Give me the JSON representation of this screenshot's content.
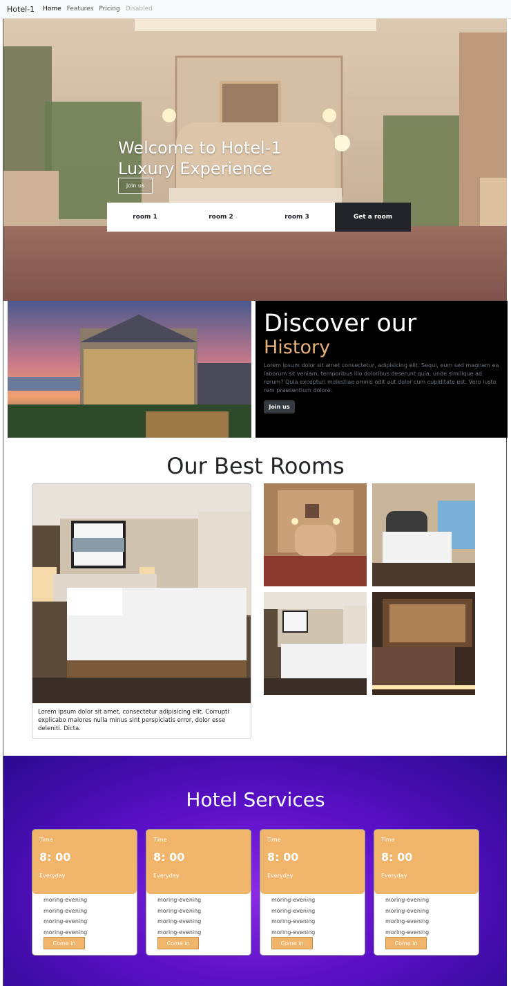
{
  "navbar": {
    "brand": "Hotel-1",
    "links": [
      "Home",
      "Features",
      "Pricing",
      "Disabled"
    ]
  },
  "hero": {
    "title_line1": "Welcome to Hotel-1",
    "title_line2": "Luxury Experience",
    "join_label": "Join us",
    "tabs": [
      "room 1",
      "room 2",
      "room 3",
      "Get a room"
    ]
  },
  "discover": {
    "heading": "Discover our",
    "subheading": "History",
    "text": "Lorem ipsum dolor sit amet consectetur, adipisicing elit. Sequi, eum sed magnam ea laborum sit veniam, temporibus illo doloribus deserunt quia, unde similique ad rerum? Quia excepturi molestiae omnis odit aut dolor cum cupiditate est. Vero iusto rem praesentium dolore.",
    "button_label": "Join us"
  },
  "rooms": {
    "title": "Our Best Rooms",
    "card_text": "Lorem ipsum dolor sit amet, consectetur adipisicing elit. Corrupti explicabo maiores nulla minus sint perspiciatis error, dolor esse deleniti. Dicta."
  },
  "services": {
    "title": "Hotel Services",
    "cards": [
      {
        "label": "Time",
        "hour": "8: 00",
        "freq": "Everyday",
        "lines": [
          "moring-evening",
          "moring-evening",
          "moring-evening",
          "moring-evening"
        ],
        "button": "Come in"
      },
      {
        "label": "Time",
        "hour": "8: 00",
        "freq": "Everyday",
        "lines": [
          "moring-evening",
          "moring-evening",
          "moring-evening",
          "moring-evening"
        ],
        "button": "Come in"
      },
      {
        "label": "Time",
        "hour": "8: 00",
        "freq": "Everyday",
        "lines": [
          "moring-evening",
          "moring-evening",
          "moring-evening",
          "moring-evening"
        ],
        "button": "Come in"
      },
      {
        "label": "Time",
        "hour": "8: 00",
        "freq": "Everyday",
        "lines": [
          "moring-evening",
          "moring-evening",
          "moring-evening",
          "moring-evening"
        ],
        "button": "Come in"
      }
    ]
  },
  "colors": {
    "accent": "#f0b46a",
    "dark": "#212529",
    "services_bg": "#5b10c8"
  }
}
